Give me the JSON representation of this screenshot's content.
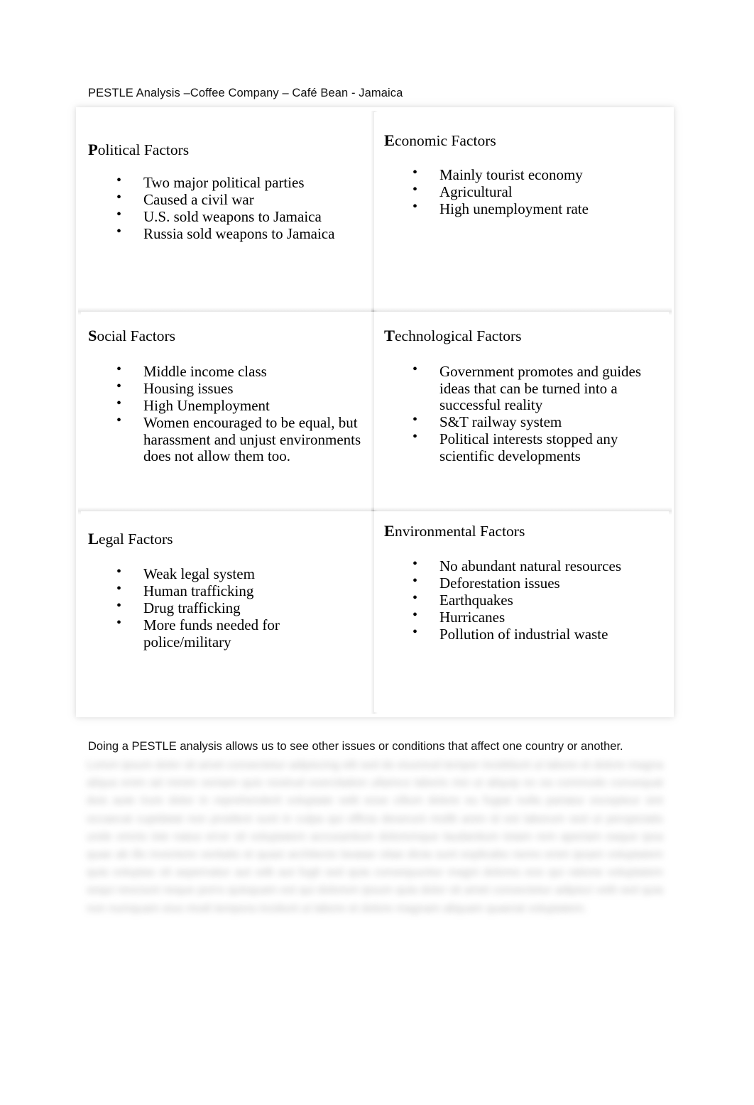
{
  "document": {
    "title": "PESTLE Analysis –Coffee Company – Café Bean - Jamaica",
    "background_color": "#ffffff",
    "text_color": "#000000",
    "border_color": "#d9d9d9"
  },
  "pestle": {
    "cells": [
      {
        "key": "political",
        "cap": "P",
        "heading_rest": "olitical Factors",
        "heading": "Political Factors",
        "items": [
          "Two major political parties",
          "Caused a civil war",
          "U.S. sold weapons to Jamaica",
          "Russia sold weapons to Jamaica"
        ]
      },
      {
        "key": "economic",
        "cap": "E",
        "heading_rest": "conomic Factors",
        "heading": "Economic Factors",
        "items": [
          "Mainly tourist economy",
          "Agricultural",
          "High unemployment rate"
        ]
      },
      {
        "key": "social",
        "cap": "S",
        "heading_rest": "ocial Factors",
        "heading": "Social Factors",
        "items": [
          "Middle income class",
          "Housing issues",
          "High Unemployment",
          "Women encouraged to be equal, but harassment and unjust environments does not allow them too."
        ]
      },
      {
        "key": "technological",
        "cap": "T",
        "heading_rest": "echnological Factors",
        "heading": "Technological Factors",
        "items": [
          "Government promotes and guides ideas that can be turned into a successful reality",
          "S&T railway system",
          "Political interests stopped any scientific developments"
        ]
      },
      {
        "key": "legal",
        "cap": "L",
        "heading_rest": "egal Factors",
        "heading": "Legal Factors",
        "items": [
          "Weak legal system",
          "Human trafficking",
          "Drug trafficking",
          "More funds needed for police/military"
        ]
      },
      {
        "key": "environmental",
        "cap": "E",
        "heading_rest": "nvironmental Factors",
        "heading": "Environmental Factors",
        "items": [
          "No abundant natural resources",
          "Deforestation issues",
          "Earthquakes",
          "Hurricanes",
          "Pollution of industrial waste"
        ]
      }
    ]
  },
  "closing": {
    "paragraph": "Doing a PESTLE analysis allows us to see other issues or conditions that affect one country or another.",
    "redacted_note": "[remaining body text is blurred and unreadable in the source image]",
    "redacted_filler": "Lorem ipsum dolor sit amet consectetur adipiscing elit sed do eiusmod tempor incididunt ut labore et dolore magna aliqua enim ad minim veniam quis nostrud exercitation ullamco laboris nisi ut aliquip ex ea commodo consequat duis aute irure dolor in reprehenderit voluptate velit esse cillum dolore eu fugiat nulla pariatur excepteur sint occaecat cupidatat non proident sunt in culpa qui officia deserunt mollit anim id est laborum sed ut perspiciatis unde omnis iste natus error sit voluptatem accusantium doloremque laudantium totam rem aperiam eaque ipsa quae ab illo inventore veritatis et quasi architecto beatae vitae dicta sunt explicabo nemo enim ipsam voluptatem quia voluptas sit aspernatur aut odit aut fugit sed quia consequuntur magni dolores eos qui ratione voluptatem sequi nesciunt neque porro quisquam est qui dolorem ipsum quia dolor sit amet consectetur adipisci velit sed quia non numquam eius modi tempora incidunt ut labore et dolore magnam aliquam quaerat voluptatem."
  }
}
